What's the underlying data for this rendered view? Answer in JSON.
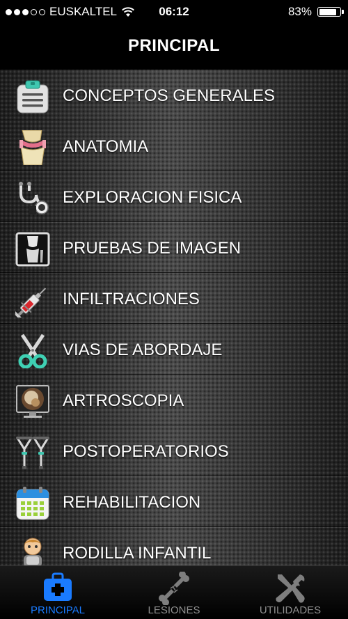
{
  "status_bar": {
    "carrier": "EUSKALTEL",
    "time": "06:12",
    "battery_percent_text": "83%",
    "battery_level": 0.83,
    "signal_bars_filled": 3,
    "signal_bars_total": 5
  },
  "nav": {
    "title": "PRINCIPAL"
  },
  "menu": {
    "items": [
      {
        "label": "CONCEPTOS GENERALES",
        "icon": "clipboard-icon"
      },
      {
        "label": "ANATOMIA",
        "icon": "knee-joint-icon"
      },
      {
        "label": "EXPLORACION FISICA",
        "icon": "stethoscope-icon"
      },
      {
        "label": "PRUEBAS DE IMAGEN",
        "icon": "xray-icon"
      },
      {
        "label": "INFILTRACIONES",
        "icon": "syringe-icon"
      },
      {
        "label": "VIAS DE ABORDAJE",
        "icon": "scissors-icon"
      },
      {
        "label": "ARTROSCOPIA",
        "icon": "arthroscopy-monitor-icon"
      },
      {
        "label": "POSTOPERATORIOS",
        "icon": "crutches-icon"
      },
      {
        "label": "REHABILITACION",
        "icon": "calendar-icon"
      },
      {
        "label": "RODILLA INFANTIL",
        "icon": "child-icon"
      }
    ]
  },
  "tabs": {
    "items": [
      {
        "label": "PRINCIPAL",
        "icon": "medical-kit-icon",
        "active": true
      },
      {
        "label": "LESIONES",
        "icon": "broken-bone-icon",
        "active": false
      },
      {
        "label": "UTILIDADES",
        "icon": "tools-icon",
        "active": false
      }
    ]
  },
  "colors": {
    "accent": "#1a7bff",
    "tab_inactive": "#8f8f8f",
    "bar_background": "#000000"
  }
}
